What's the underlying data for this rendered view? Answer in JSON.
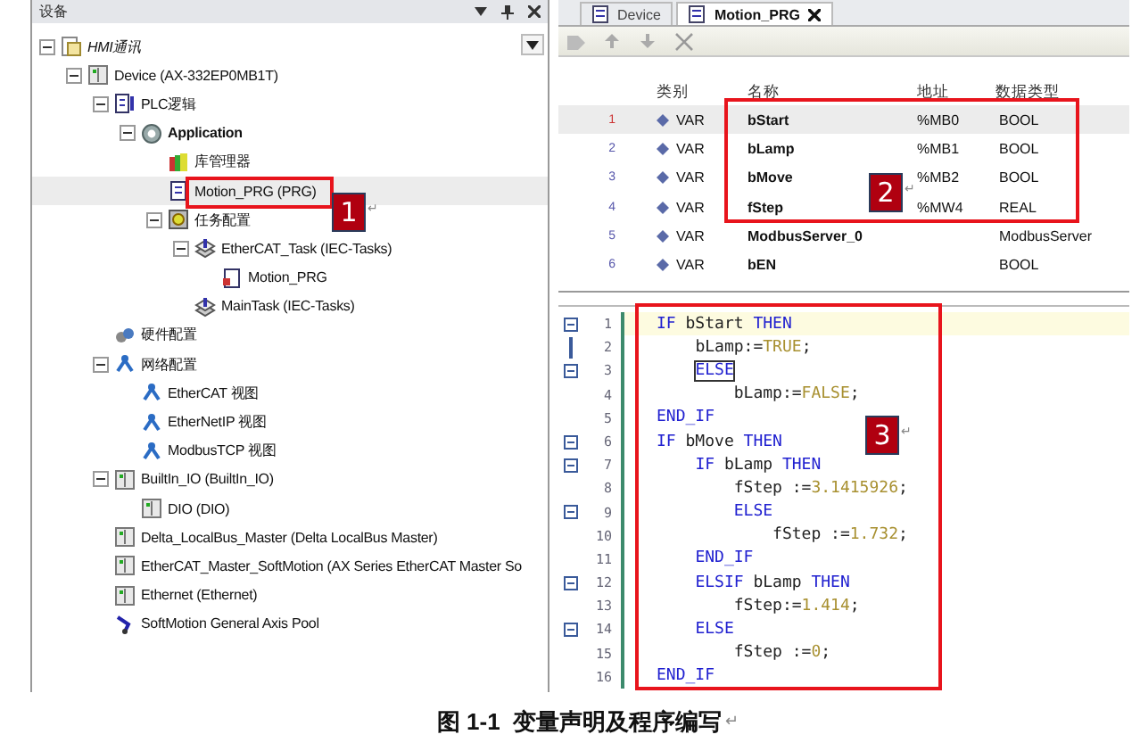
{
  "devices_panel": {
    "title": "设备",
    "tree": [
      {
        "label": "HMI通讯",
        "kind": "project",
        "italic": true,
        "expanded": true,
        "selected": false,
        "children": [
          {
            "label": "Device (AX-332EP0MB1T)",
            "kind": "device",
            "expanded": true,
            "selected": false,
            "children": [
              {
                "label": "PLC逻辑",
                "kind": "plc",
                "expanded": true,
                "selected": false,
                "children": [
                  {
                    "label": "Application",
                    "kind": "app",
                    "bold": true,
                    "expanded": true,
                    "selected": false,
                    "children": [
                      {
                        "label": "库管理器",
                        "kind": "library",
                        "selected": false
                      },
                      {
                        "label": "Motion_PRG (PRG)",
                        "kind": "pou",
                        "selected": true
                      },
                      {
                        "label": "任务配置",
                        "kind": "tasks",
                        "expanded": true,
                        "selected": false,
                        "children": [
                          {
                            "label": "EtherCAT_Task (IEC-Tasks)",
                            "kind": "task",
                            "expanded": true,
                            "selected": false,
                            "children": [
                              {
                                "label": "Motion_PRG",
                                "kind": "call",
                                "selected": false
                              }
                            ]
                          },
                          {
                            "label": "MainTask (IEC-Tasks)",
                            "kind": "task",
                            "selected": false
                          }
                        ]
                      }
                    ]
                  }
                ]
              },
              {
                "label": "硬件配置",
                "kind": "hardware",
                "selected": false
              },
              {
                "label": "网络配置",
                "kind": "network",
                "expanded": true,
                "selected": false,
                "children": [
                  {
                    "label": "EtherCAT 视图",
                    "kind": "network",
                    "selected": false
                  },
                  {
                    "label": "EtherNetIP 视图",
                    "kind": "network",
                    "selected": false
                  },
                  {
                    "label": "ModbusTCP 视图",
                    "kind": "network",
                    "selected": false
                  }
                ]
              },
              {
                "label": "BuiltIn_IO (BuiltIn_IO)",
                "kind": "device",
                "expanded": true,
                "selected": false,
                "children": [
                  {
                    "label": "DIO (DIO)",
                    "kind": "device",
                    "selected": false
                  }
                ]
              },
              {
                "label": "Delta_LocalBus_Master (Delta LocalBus Master)",
                "kind": "device",
                "selected": false
              },
              {
                "label": "EtherCAT_Master_SoftMotion (AX Series EtherCAT Master So",
                "kind": "device",
                "selected": false
              },
              {
                "label": "Ethernet (Ethernet)",
                "kind": "device",
                "selected": false
              },
              {
                "label": "SoftMotion General Axis Pool",
                "kind": "axis",
                "selected": false
              }
            ]
          }
        ]
      }
    ]
  },
  "editor_tabs": [
    {
      "label": "Device",
      "selected": false
    },
    {
      "label": "Motion_PRG",
      "selected": true
    }
  ],
  "declarations": {
    "columns": [
      "类别",
      "名称",
      "地址",
      "数据类型"
    ],
    "rows": [
      {
        "line": "1",
        "category": "VAR",
        "name": "bStart",
        "address": "%MB0",
        "type": "BOOL",
        "selected": true
      },
      {
        "line": "2",
        "category": "VAR",
        "name": "bLamp",
        "address": "%MB1",
        "type": "BOOL",
        "selected": false
      },
      {
        "line": "3",
        "category": "VAR",
        "name": "bMove",
        "address": "%MB2",
        "type": "BOOL",
        "selected": false
      },
      {
        "line": "4",
        "category": "VAR",
        "name": "fStep",
        "address": "%MW4",
        "type": "REAL",
        "selected": false
      },
      {
        "line": "5",
        "category": "VAR",
        "name": "ModbusServer_0",
        "type": "ModbusServer",
        "selected": false
      },
      {
        "line": "6",
        "category": "VAR",
        "name": "bEN",
        "type": "BOOL",
        "selected": false
      }
    ]
  },
  "code": [
    {
      "line": "1",
      "kind": "block",
      "current": true,
      "tokens": [
        {
          "kind": "keyword",
          "text": "IF"
        },
        {
          "kind": "ident",
          "text": " bStart "
        },
        {
          "kind": "keyword",
          "text": "THEN"
        }
      ]
    },
    {
      "line": "2",
      "kind": "inner",
      "current": false,
      "tokens": [
        {
          "kind": "ident",
          "text": "    bLamp:="
        },
        {
          "kind": "literal",
          "text": "TRUE"
        },
        {
          "kind": "ident",
          "text": ";"
        }
      ]
    },
    {
      "line": "3",
      "kind": "block",
      "current": false,
      "tokens": [
        {
          "kind": "keyword",
          "text": "    ELSE",
          "boxed": true
        }
      ]
    },
    {
      "line": "4",
      "kind": "plain",
      "current": false,
      "tokens": [
        {
          "kind": "ident",
          "text": "        bLamp:="
        },
        {
          "kind": "literal",
          "text": "FALSE"
        },
        {
          "kind": "ident",
          "text": ";"
        }
      ]
    },
    {
      "line": "5",
      "kind": "plain",
      "current": false,
      "tokens": [
        {
          "kind": "keyword",
          "text": "END_IF"
        }
      ]
    },
    {
      "line": "6",
      "kind": "block",
      "current": false,
      "tokens": [
        {
          "kind": "keyword",
          "text": "IF"
        },
        {
          "kind": "ident",
          "text": " bMove "
        },
        {
          "kind": "keyword",
          "text": "THEN"
        }
      ]
    },
    {
      "line": "7",
      "kind": "block",
      "current": false,
      "tokens": [
        {
          "kind": "keyword",
          "text": "    IF"
        },
        {
          "kind": "ident",
          "text": " bLamp "
        },
        {
          "kind": "keyword",
          "text": "THEN"
        }
      ]
    },
    {
      "line": "8",
      "kind": "plain",
      "current": false,
      "tokens": [
        {
          "kind": "ident",
          "text": "        fStep :="
        },
        {
          "kind": "literal",
          "text": "3.1415926"
        },
        {
          "kind": "ident",
          "text": ";"
        }
      ]
    },
    {
      "line": "9",
      "kind": "block",
      "current": false,
      "tokens": [
        {
          "kind": "keyword",
          "text": "        ELSE"
        }
      ]
    },
    {
      "line": "10",
      "kind": "plain",
      "current": false,
      "tokens": [
        {
          "kind": "ident",
          "text": "            fStep :="
        },
        {
          "kind": "literal",
          "text": "1.732"
        },
        {
          "kind": "ident",
          "text": ";"
        }
      ]
    },
    {
      "line": "11",
      "kind": "plain",
      "current": false,
      "tokens": [
        {
          "kind": "keyword",
          "text": "    END_IF"
        }
      ]
    },
    {
      "line": "12",
      "kind": "block",
      "current": false,
      "tokens": [
        {
          "kind": "keyword",
          "text": "    ELSIF"
        },
        {
          "kind": "ident",
          "text": " bLamp "
        },
        {
          "kind": "keyword",
          "text": "THEN"
        }
      ]
    },
    {
      "line": "13",
      "kind": "plain",
      "current": false,
      "tokens": [
        {
          "kind": "ident",
          "text": "        fStep:="
        },
        {
          "kind": "literal",
          "text": "1.414"
        },
        {
          "kind": "ident",
          "text": ";"
        }
      ]
    },
    {
      "line": "14",
      "kind": "block",
      "current": false,
      "tokens": [
        {
          "kind": "keyword",
          "text": "    ELSE"
        }
      ]
    },
    {
      "line": "15",
      "kind": "plain",
      "current": false,
      "tokens": [
        {
          "kind": "ident",
          "text": "        fStep :="
        },
        {
          "kind": "literal",
          "text": "0"
        },
        {
          "kind": "ident",
          "text": ";"
        }
      ]
    },
    {
      "line": "16",
      "kind": "plain",
      "current": false,
      "tokens": [
        {
          "kind": "keyword",
          "text": "END_IF"
        }
      ]
    }
  ],
  "callouts": [
    {
      "label": "1",
      "mark": "↵"
    },
    {
      "label": "2",
      "mark": "↵"
    },
    {
      "label": "3",
      "mark": "↵"
    }
  ],
  "caption": {
    "text": "图 1-1  变量声明及程序编写",
    "mark": "↵"
  }
}
